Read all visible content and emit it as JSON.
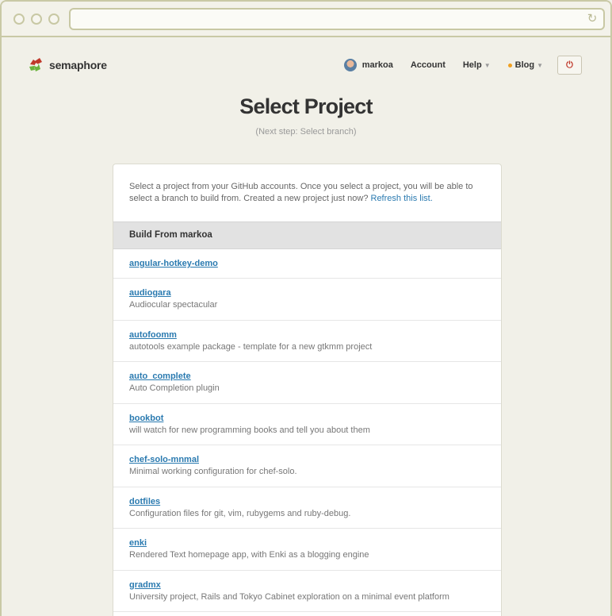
{
  "brand": {
    "name": "semaphore"
  },
  "nav": {
    "username": "markoa",
    "account": "Account",
    "help": "Help",
    "blog": "Blog",
    "power_icon": "⏻"
  },
  "page": {
    "title": "Select Project",
    "subtitle": "(Next step: Select branch)"
  },
  "intro": {
    "text": "Select a project from your GitHub accounts. Once you select a project, you will be able to select a branch to build from. Created a new project just now? ",
    "refresh_link": "Refresh this list."
  },
  "section": {
    "title": "Build From markoa"
  },
  "projects": [
    {
      "name": "angular-hotkey-demo",
      "desc": ""
    },
    {
      "name": "audiogara",
      "desc": "Audiocular spectacular"
    },
    {
      "name": "autofoomm",
      "desc": "autotools example package - template for a new gtkmm project"
    },
    {
      "name": "auto_complete",
      "desc": "Auto Completion plugin"
    },
    {
      "name": "bookbot",
      "desc": "will watch for new programming books and tell you about them"
    },
    {
      "name": "chef-solo-mnmal",
      "desc": "Minimal working configuration for chef-solo."
    },
    {
      "name": "dotfiles",
      "desc": "Configuration files for git, vim, rubygems and ruby-debug."
    },
    {
      "name": "enki",
      "desc": "Rendered Text homepage app, with Enki as a blogging engine"
    },
    {
      "name": "gradmx",
      "desc": "University project, Rails and Tokyo Cabinet exploration on a minimal event platform"
    }
  ],
  "colors": {
    "background": "#f1f0e8",
    "link": "#2a7ab0",
    "accent_red": "#c0392b",
    "accent_green": "#6cb33e",
    "blog_dot": "#f0a020"
  }
}
